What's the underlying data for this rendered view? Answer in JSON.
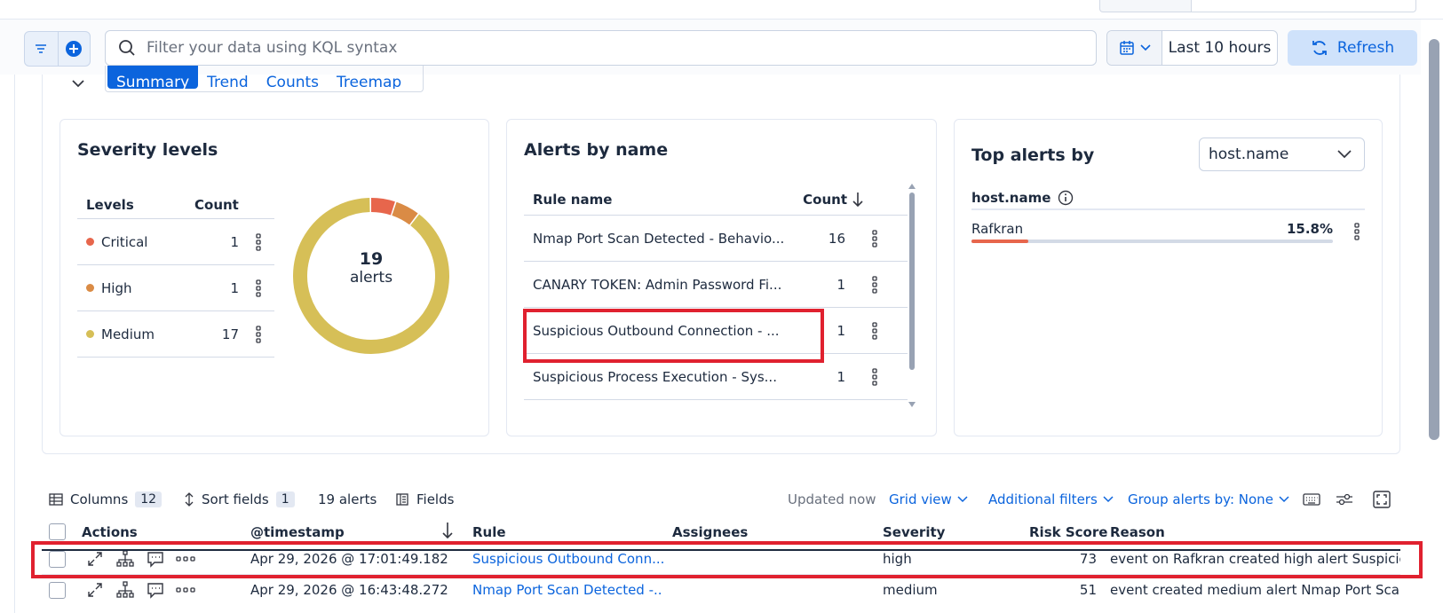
{
  "query": {
    "placeholder": "Filter your data using KQL syntax",
    "date_range": "Last 10 hours",
    "refresh_label": "Refresh"
  },
  "summary": {
    "tabs": [
      {
        "label": "Summary",
        "active": true
      },
      {
        "label": "Trend",
        "active": false
      },
      {
        "label": "Counts",
        "active": false
      },
      {
        "label": "Treemap",
        "active": false
      }
    ]
  },
  "severity": {
    "title": "Severity levels",
    "col_levels": "Levels",
    "col_count": "Count",
    "rows": [
      {
        "level": "Critical",
        "count": "1",
        "color": "#e7664c"
      },
      {
        "level": "High",
        "count": "1",
        "color": "#da8b45"
      },
      {
        "level": "Medium",
        "count": "17",
        "color": "#d6bf57"
      }
    ],
    "donut_total": "19",
    "donut_label": "alerts"
  },
  "alerts_by_name": {
    "title": "Alerts by name",
    "col_rule": "Rule name",
    "col_count": "Count",
    "rows": [
      {
        "rule": "Nmap Port Scan Detected - Behavio...",
        "count": "16"
      },
      {
        "rule": "CANARY TOKEN: Admin Password Fi...",
        "count": "1"
      },
      {
        "rule": "Suspicious Outbound Connection - ...",
        "count": "1"
      },
      {
        "rule": "Suspicious Process Execution - Sys...",
        "count": "1"
      }
    ]
  },
  "top_alerts": {
    "title": "Top alerts by",
    "field_select": "host.name",
    "col_header": "host.name",
    "rows": [
      {
        "name": "Rafkran",
        "percent": "15.8%",
        "fraction": 0.158
      }
    ]
  },
  "toolbar": {
    "columns_label": "Columns",
    "columns_count": "12",
    "sort_label": "Sort fields",
    "sort_count": "1",
    "alerts_count": "19 alerts",
    "fields_label": "Fields",
    "updated": "Updated now",
    "grid_view": "Grid view",
    "additional_filters": "Additional filters",
    "group_by": "Group alerts by: None"
  },
  "grid": {
    "headers": {
      "actions": "Actions",
      "timestamp": "@timestamp",
      "rule": "Rule",
      "assignees": "Assignees",
      "severity": "Severity",
      "risk": "Risk Score",
      "reason": "Reason"
    },
    "rows": [
      {
        "timestamp": "Apr 29, 2026 @ 17:01:49.182",
        "rule": "Suspicious Outbound Conn...",
        "assignees": "",
        "severity": "high",
        "risk": "73",
        "reason": "event on Rafkran created high alert Suspicious"
      },
      {
        "timestamp": "Apr 29, 2026 @ 16:43:48.272",
        "rule": "Nmap Port Scan Detected -...",
        "assignees": "",
        "severity": "medium",
        "risk": "51",
        "reason": "event created medium alert Nmap Port Scan D"
      }
    ]
  },
  "colors": {
    "accent": "#0b64dd",
    "highlight": "#e0212f"
  }
}
